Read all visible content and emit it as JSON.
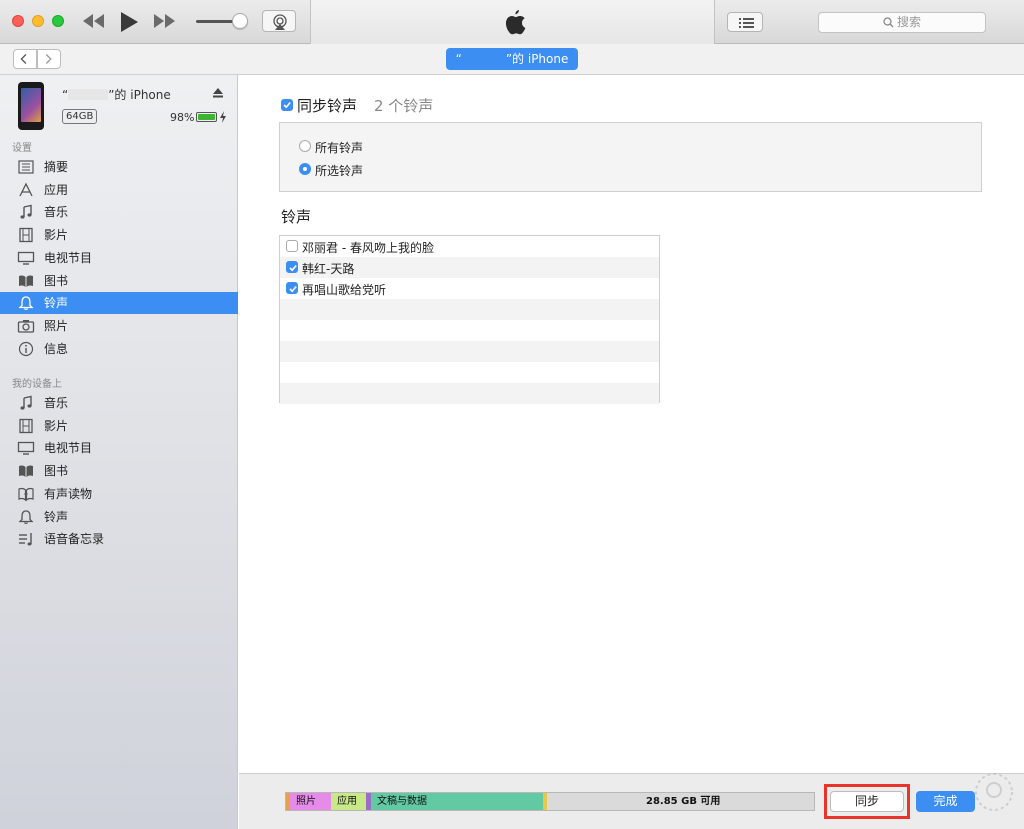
{
  "search": {
    "placeholder": "搜索"
  },
  "device": {
    "title_prefix": "“",
    "title_suffix": "”的 iPhone",
    "capacity": "64GB",
    "battery": "98%",
    "battery_level": 0.98
  },
  "sidebar": {
    "settings_label": "设置",
    "settings_items": [
      {
        "label": "摘要",
        "icon": "summary-icon"
      },
      {
        "label": "应用",
        "icon": "apps-icon"
      },
      {
        "label": "音乐",
        "icon": "music-icon"
      },
      {
        "label": "影片",
        "icon": "film-icon"
      },
      {
        "label": "电视节目",
        "icon": "tv-icon"
      },
      {
        "label": "图书",
        "icon": "book-icon"
      },
      {
        "label": "铃声",
        "icon": "bell-icon",
        "active": true
      },
      {
        "label": "照片",
        "icon": "camera-icon"
      },
      {
        "label": "信息",
        "icon": "info-icon"
      }
    ],
    "mydevice_label": "我的设备上",
    "mydevice_items": [
      {
        "label": "音乐",
        "icon": "music-icon"
      },
      {
        "label": "影片",
        "icon": "film-icon"
      },
      {
        "label": "电视节目",
        "icon": "tv-icon"
      },
      {
        "label": "图书",
        "icon": "book-icon"
      },
      {
        "label": "有声读物",
        "icon": "audiobook-icon"
      },
      {
        "label": "铃声",
        "icon": "bell-icon"
      },
      {
        "label": "语音备忘录",
        "icon": "voice-memo-icon"
      }
    ]
  },
  "main": {
    "sync_title": "同步铃声",
    "sync_count": "2 个铃声",
    "sync_checked": true,
    "options": [
      {
        "label": "所有铃声",
        "selected": false
      },
      {
        "label": "所选铃声",
        "selected": true
      }
    ],
    "section_title": "铃声",
    "ringtones": [
      {
        "label": "邓丽君 - 春风吻上我的脸",
        "checked": false
      },
      {
        "label": "韩红-天路",
        "checked": true
      },
      {
        "label": "再唱山歌给党听",
        "checked": true
      }
    ]
  },
  "storage": {
    "photos": "照片",
    "apps": "应用",
    "docs": "文稿与数据",
    "free": "28.85 GB 可用"
  },
  "buttons": {
    "sync": "同步",
    "done": "完成"
  },
  "colors": {
    "accent": "#3c8ef3",
    "highlight": "#e8342b",
    "photos": "#e58be8",
    "apps": "#c9e88a",
    "docs": "#62c9a2"
  }
}
